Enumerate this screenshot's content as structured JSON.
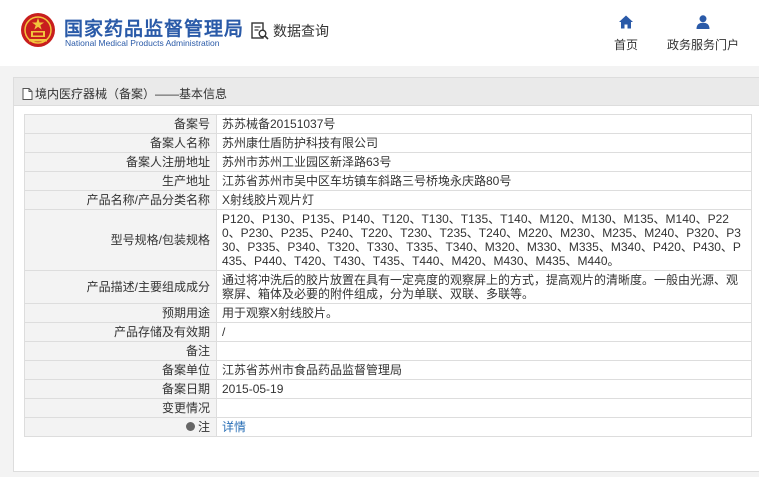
{
  "header": {
    "brand_cn": "国家药品监督管理局",
    "brand_en": "National Medical Products Administration",
    "query_label": "数据查询",
    "nav": [
      {
        "label": "首页",
        "icon": "home-icon"
      },
      {
        "label": "政务服务门户",
        "icon": "user-icon"
      }
    ],
    "brand_color": "#2a5aa8",
    "logo_color": "#c81e1e"
  },
  "panel": {
    "title": "境内医疗器械（备案）——基本信息"
  },
  "details": [
    {
      "label": "备案号",
      "value": "苏苏械备20151037号"
    },
    {
      "label": "备案人名称",
      "value": "苏州康仕盾防护科技有限公司"
    },
    {
      "label": "备案人注册地址",
      "value": "苏州市苏州工业园区新泽路63号"
    },
    {
      "label": "生产地址",
      "value": "江苏省苏州市吴中区车坊镇车斜路三号桥堍永庆路80号"
    },
    {
      "label": "产品名称/产品分类名称",
      "value": "X射线胶片观片灯"
    },
    {
      "label": "型号规格/包装规格",
      "value": "P120、P130、P135、P140、T120、T130、T135、T140、M120、M130、M135、M140、P220、P230、P235、P240、T220、T230、T235、T240、M220、M230、M235、M240、P320、P330、P335、P340、T320、T330、T335、T340、M320、M330、M335、M340、P420、P430、P435、P440、T420、T430、T435、T440、M420、M430、M435、M440。"
    },
    {
      "label": "产品描述/主要组成成分",
      "value": "通过将冲洗后的胶片放置在具有一定亮度的观察屏上的方式，提高观片的清晰度。一般由光源、观察屏、箱体及必要的附件组成，分为单联、双联、多联等。"
    },
    {
      "label": "预期用途",
      "value": "用于观察X射线胶片。"
    },
    {
      "label": "产品存储及有效期",
      "value": "/"
    },
    {
      "label": "备注",
      "value": ""
    },
    {
      "label": "备案单位",
      "value": "江苏省苏州市食品药品监督管理局"
    },
    {
      "label": "备案日期",
      "value": "2015-05-19"
    },
    {
      "label": "变更情况",
      "value": ""
    }
  ],
  "note_row": {
    "label": "注",
    "link": "详情"
  }
}
